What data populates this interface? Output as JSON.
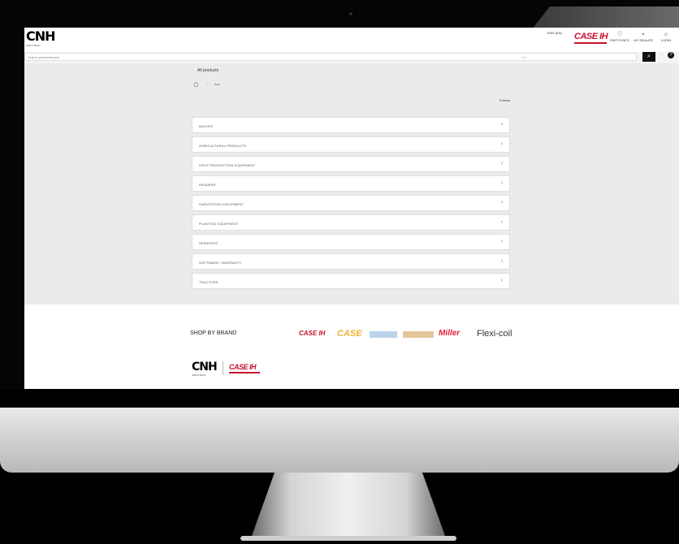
{
  "header": {
    "logo": "CNH",
    "logo_sub": "INDUSTRIAL",
    "lang": "ENG (EN)",
    "brand_logo": "CASE IH",
    "nav": [
      {
        "icon": "info-icon",
        "label": "PARTS INFO"
      },
      {
        "icon": "pin-icon",
        "label": "MY DEALER"
      },
      {
        "icon": "user-icon",
        "label": "LOGIN"
      }
    ]
  },
  "search": {
    "placeholder": "Search parts/category",
    "scope": "ALL",
    "button_icon": "search-icon",
    "help_icon": "help-icon"
  },
  "page": {
    "title": "All products",
    "breadcrumb_current": "Parts"
  },
  "items_count": "9 Items",
  "categories": [
    {
      "label": "BALERS"
    },
    {
      "label": "AGRICULTURAL PRODUCTS"
    },
    {
      "label": "CROP PRODUCTION EQUIPMENT"
    },
    {
      "label": "HEADERS"
    },
    {
      "label": "HARVESTING EQUIPMENT"
    },
    {
      "label": "PLANTING EQUIPMENT"
    },
    {
      "label": "SPRAYERS"
    },
    {
      "label": "SOFTWARE / WARRANTY"
    },
    {
      "label": "TRACTORS"
    }
  ],
  "footer": {
    "shop_by_brand": "SHOP BY BRAND",
    "brands": [
      "CASE IH",
      "CASE",
      "Miller",
      "Flexi-coil"
    ],
    "logo": "CNH",
    "logo_sub": "INDUSTRIAL",
    "case_logo": "CASE IH"
  },
  "colors": {
    "case_red": "#c8102e",
    "case_yellow": "#f1b233",
    "miller_red": "#e31e3b"
  }
}
